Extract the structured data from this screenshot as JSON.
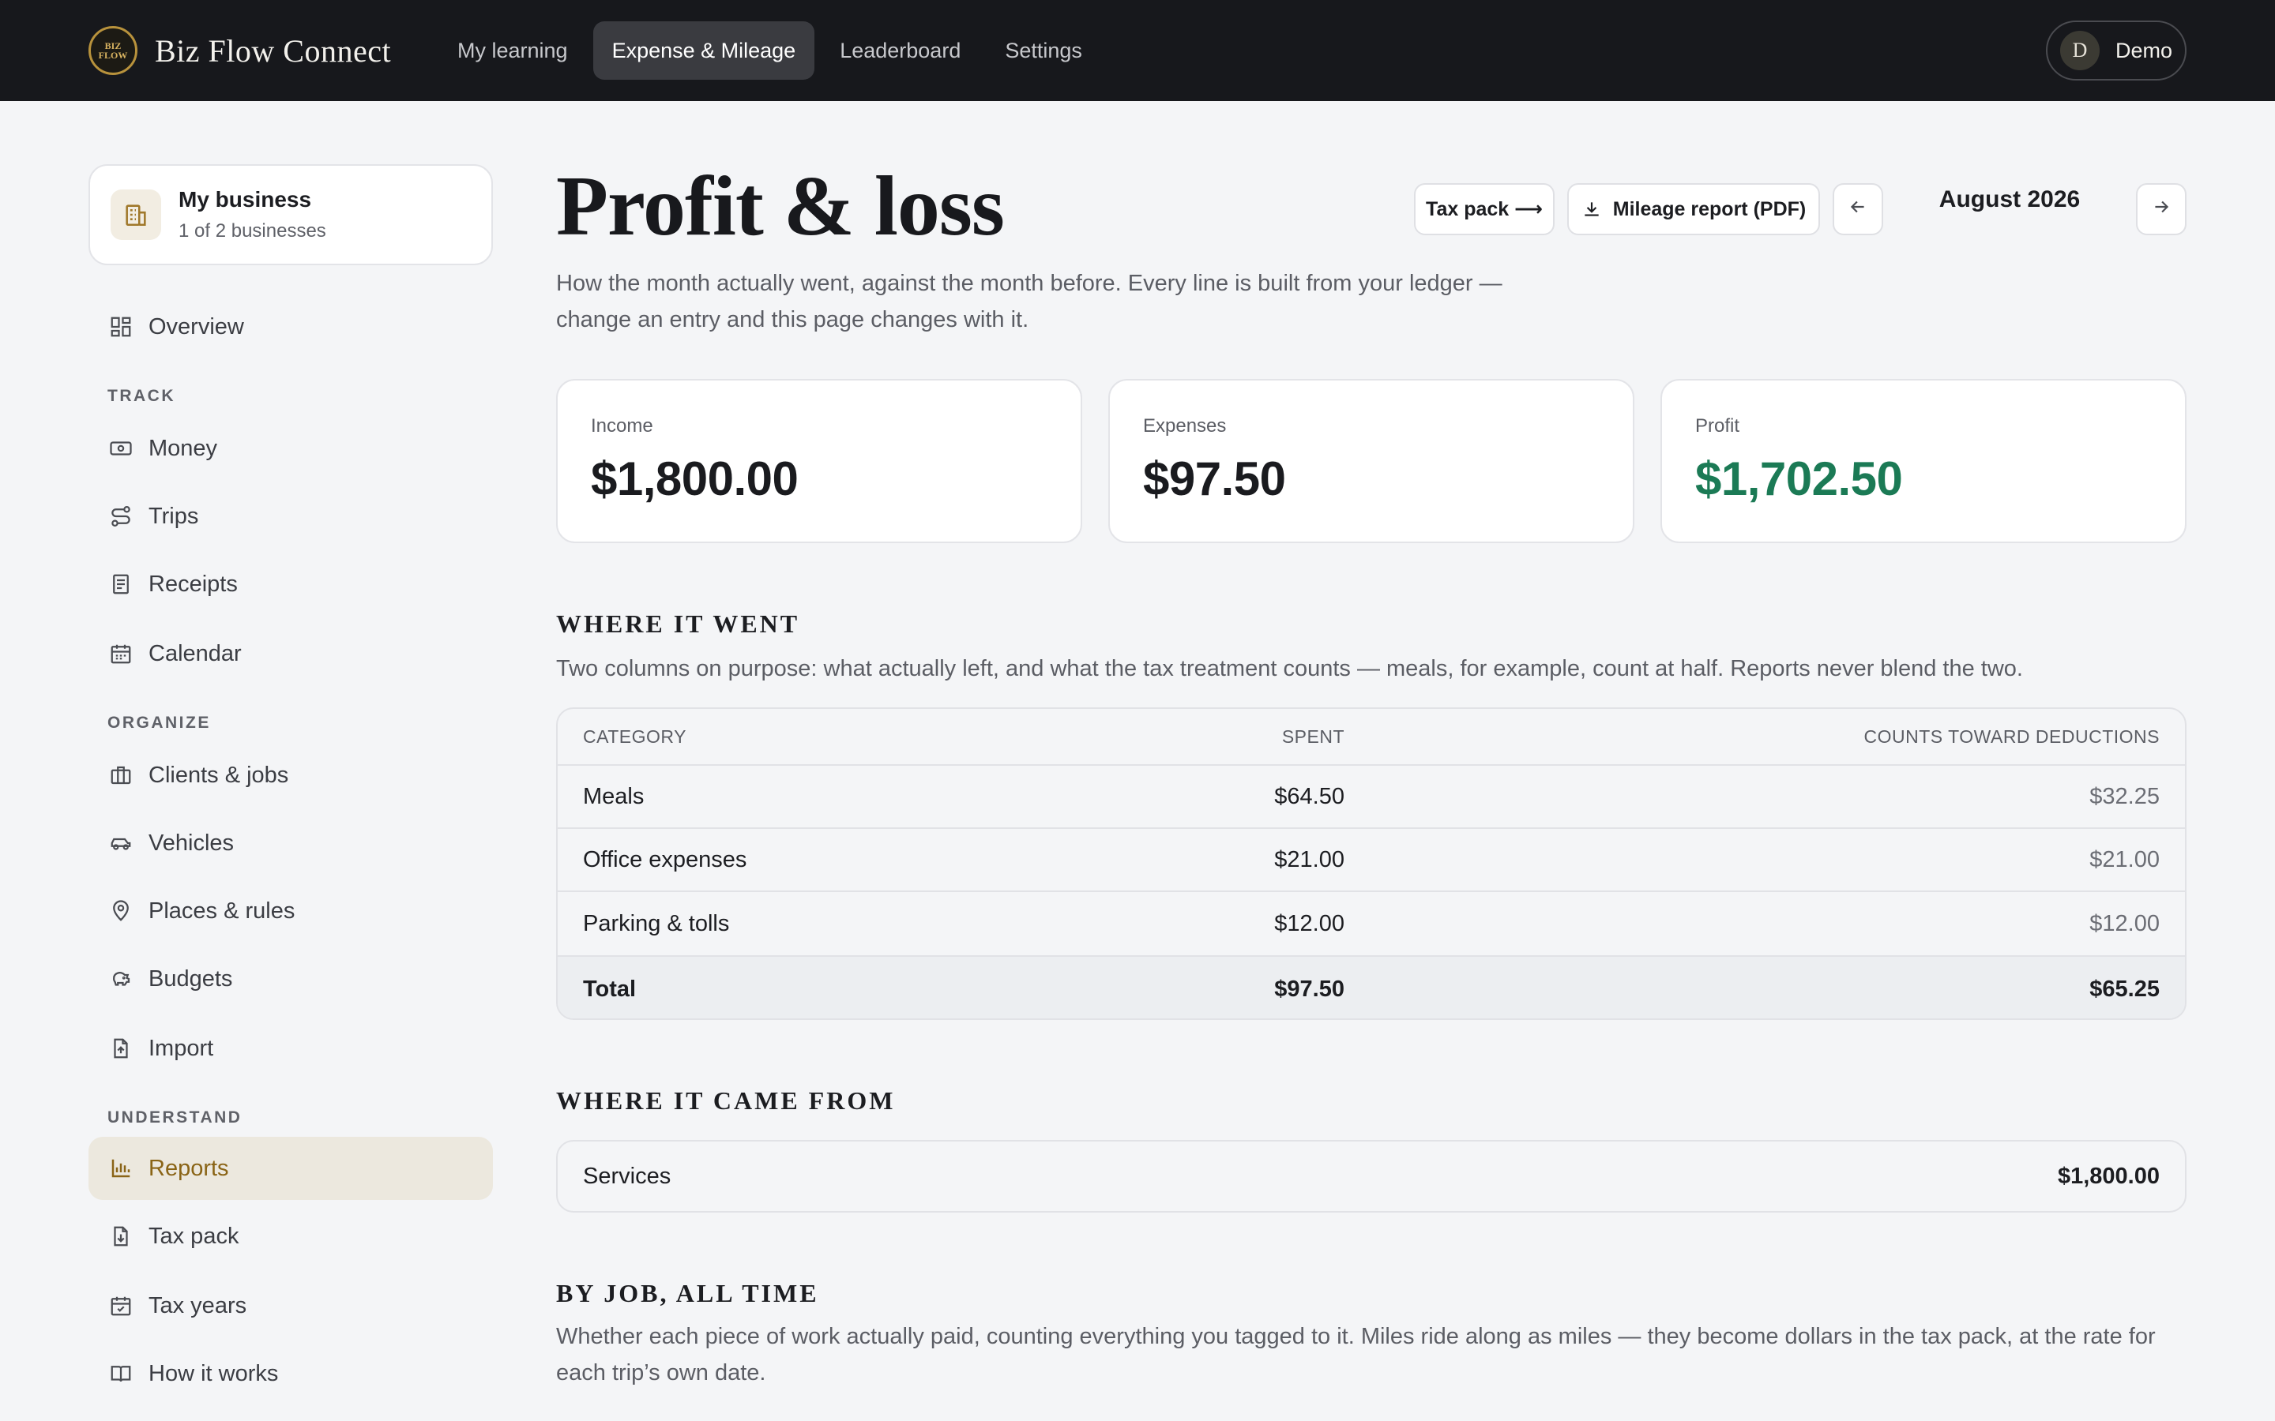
{
  "brand": {
    "name": "Biz Flow Connect",
    "logo_text_1": "BIZ",
    "logo_text_2": "FLOW"
  },
  "nav": {
    "items": [
      {
        "label": "My learning"
      },
      {
        "label": "Expense & Mileage",
        "active": true
      },
      {
        "label": "Leaderboard"
      },
      {
        "label": "Settings"
      }
    ]
  },
  "user": {
    "initial": "D",
    "name": "Demo"
  },
  "business": {
    "title": "My business",
    "subtitle": "1 of 2 businesses"
  },
  "sidebar": {
    "overview": "Overview",
    "sections": {
      "track": "TRACK",
      "organize": "ORGANIZE",
      "understand": "UNDERSTAND"
    },
    "items": [
      {
        "label": "Money",
        "icon": "money-icon"
      },
      {
        "label": "Trips",
        "icon": "route-icon"
      },
      {
        "label": "Receipts",
        "icon": "receipt-icon"
      },
      {
        "label": "Calendar",
        "icon": "calendar-icon"
      },
      {
        "label": "Clients & jobs",
        "icon": "briefcase-icon"
      },
      {
        "label": "Vehicles",
        "icon": "car-icon"
      },
      {
        "label": "Places & rules",
        "icon": "map-pin-icon"
      },
      {
        "label": "Budgets",
        "icon": "piggy-bank-icon"
      },
      {
        "label": "Import",
        "icon": "file-import-icon"
      },
      {
        "label": "Reports",
        "icon": "bar-chart-icon",
        "active": true
      },
      {
        "label": "Tax pack",
        "icon": "file-download-icon"
      },
      {
        "label": "Tax years",
        "icon": "calendar-check-icon"
      },
      {
        "label": "How it works",
        "icon": "book-icon"
      }
    ]
  },
  "page": {
    "title": "Profit & loss",
    "description": "How the month actually went, against the month before. Every line is built from your ledger — change an entry and this page changes with it.",
    "tax_pack_button": "Tax pack ⟶",
    "mileage_button": "Mileage report (PDF)",
    "month": "August 2026"
  },
  "kpis": {
    "income": {
      "label": "Income",
      "value": "$1,800.00"
    },
    "expenses": {
      "label": "Expenses",
      "value": "$97.50"
    },
    "profit": {
      "label": "Profit",
      "value": "$1,702.50"
    }
  },
  "where_it_went": {
    "heading": "WHERE IT WENT",
    "description": "Two columns on purpose: what actually left, and what the tax treatment counts — meals, for example, count at half. Reports never blend the two.",
    "columns": [
      "CATEGORY",
      "SPENT",
      "COUNTS TOWARD DEDUCTIONS"
    ],
    "rows": [
      {
        "category": "Meals",
        "spent": "$64.50",
        "deductible": "$32.25"
      },
      {
        "category": "Office expenses",
        "spent": "$21.00",
        "deductible": "$21.00"
      },
      {
        "category": "Parking & tolls",
        "spent": "$12.00",
        "deductible": "$12.00"
      }
    ],
    "total": {
      "label": "Total",
      "spent": "$97.50",
      "deductible": "$65.25"
    }
  },
  "where_it_came_from": {
    "heading": "WHERE IT CAME FROM",
    "rows": [
      {
        "source": "Services",
        "amount": "$1,800.00"
      }
    ]
  },
  "by_job": {
    "heading": "BY JOB, ALL TIME",
    "description": "Whether each piece of work actually paid, counting everything you tagged to it. Miles ride along as miles — they become dollars in the tax pack, at the rate for each trip’s own date."
  },
  "colors": {
    "accent": "#8a6416",
    "profit_green": "#1b7a55",
    "topbar": "#17181c"
  }
}
